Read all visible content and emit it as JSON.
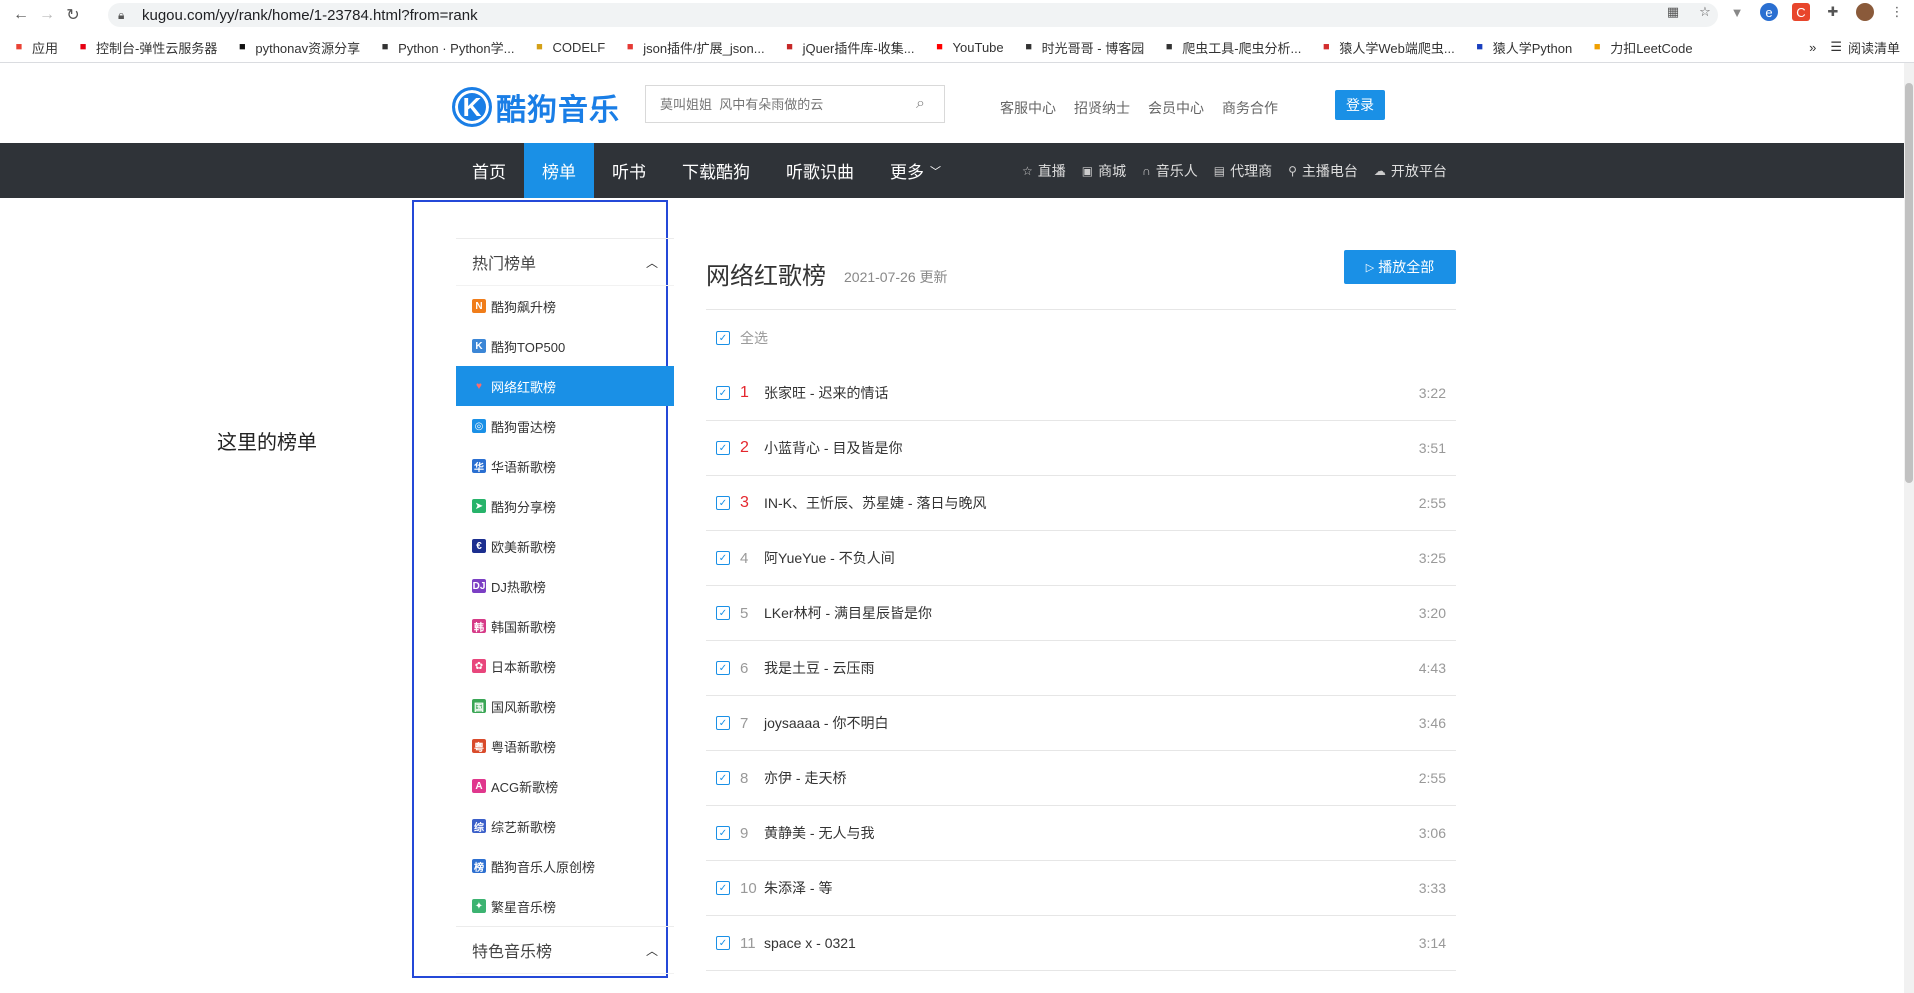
{
  "browser": {
    "url": "kugou.com/yy/rank/home/1-23784.html?from=rank",
    "bookmarks": [
      {
        "label": "应用",
        "icon": "apps-grid-icon",
        "color": "#ea4335"
      },
      {
        "label": "控制台-弹性云服务器",
        "icon": "huawei-icon",
        "color": "#e60012"
      },
      {
        "label": "pythonav资源分享",
        "icon": "github-icon",
        "color": "#111"
      },
      {
        "label": "Python · Python学...",
        "icon": "book-icon",
        "color": "#333"
      },
      {
        "label": "CODELF",
        "icon": "codelf-icon",
        "color": "#d4a017"
      },
      {
        "label": "json插件/扩展_json...",
        "icon": "ex-icon",
        "color": "#e53935"
      },
      {
        "label": "jQuer插件库-收集...",
        "icon": "jquery-icon",
        "color": "#c62828"
      },
      {
        "label": "YouTube",
        "icon": "youtube-icon",
        "color": "#ff0000"
      },
      {
        "label": "时光哥哥 - 博客园",
        "icon": "blog-icon",
        "color": "#333"
      },
      {
        "label": "爬虫工具-爬虫分析...",
        "icon": "globe-icon",
        "color": "#333"
      },
      {
        "label": "猿人学Web端爬虫...",
        "icon": "yuanrenxue-icon",
        "color": "#d32f2f"
      },
      {
        "label": "猿人学Python",
        "icon": "x-icon",
        "color": "#1a3fbf"
      },
      {
        "label": "力扣LeetCode",
        "icon": "leetcode-icon",
        "color": "#f0a000"
      }
    ],
    "overflow": "»",
    "reading_list": "阅读清单"
  },
  "header": {
    "logo_mark": "K",
    "logo_text": "酷狗音乐",
    "search_placeholder": "莫叫姐姐  风中有朵雨做的云",
    "links": [
      "客服中心",
      "招贤纳士",
      "会员中心",
      "商务合作"
    ],
    "login": "登录"
  },
  "nav": {
    "items": [
      {
        "label": "首页",
        "active": false
      },
      {
        "label": "榜单",
        "active": true
      },
      {
        "label": "听书",
        "active": false
      },
      {
        "label": "下载酷狗",
        "active": false
      },
      {
        "label": "听歌识曲",
        "active": false
      },
      {
        "label": "更多",
        "active": false
      }
    ],
    "right": [
      {
        "label": "直播",
        "icon": "star-icon"
      },
      {
        "label": "商城",
        "icon": "shop-icon"
      },
      {
        "label": "音乐人",
        "icon": "headphone-icon"
      },
      {
        "label": "代理商",
        "icon": "agent-icon"
      },
      {
        "label": "主播电台",
        "icon": "link-icon"
      },
      {
        "label": "开放平台",
        "icon": "cloud-icon"
      }
    ]
  },
  "note": "这里的榜单",
  "sidebar": {
    "section1": "热门榜单",
    "items": [
      {
        "label": "酷狗飙升榜",
        "color": "#f07d1a",
        "glyph": "N"
      },
      {
        "label": "酷狗TOP500",
        "color": "#3b86d6",
        "glyph": "K"
      },
      {
        "label": "网络红歌榜",
        "color": "#e4262d",
        "glyph": "♥",
        "active": true
      },
      {
        "label": "酷狗雷达榜",
        "color": "#1a90e6",
        "glyph": "◎"
      },
      {
        "label": "华语新歌榜",
        "color": "#2a6fd1",
        "glyph": "华"
      },
      {
        "label": "酷狗分享榜",
        "color": "#27b36a",
        "glyph": "➤"
      },
      {
        "label": "欧美新歌榜",
        "color": "#1b2e8f",
        "glyph": "€"
      },
      {
        "label": "DJ热歌榜",
        "color": "#7b3fc4",
        "glyph": "DJ"
      },
      {
        "label": "韩国新歌榜",
        "color": "#d63a87",
        "glyph": "韩"
      },
      {
        "label": "日本新歌榜",
        "color": "#e8467c",
        "glyph": "✿"
      },
      {
        "label": "国风新歌榜",
        "color": "#3aa655",
        "glyph": "国"
      },
      {
        "label": "粤语新歌榜",
        "color": "#d94b2b",
        "glyph": "粤"
      },
      {
        "label": "ACG新歌榜",
        "color": "#e0378d",
        "glyph": "A"
      },
      {
        "label": "综艺新歌榜",
        "color": "#3b5fc9",
        "glyph": "综"
      },
      {
        "label": "酷狗音乐人原创榜",
        "color": "#2d6fd0",
        "glyph": "榜"
      },
      {
        "label": "繁星音乐榜",
        "color": "#3cb371",
        "glyph": "✦"
      }
    ],
    "section2": "特色音乐榜"
  },
  "content": {
    "title": "网络红歌榜",
    "date": "2021-07-26 更新",
    "play_all": "播放全部",
    "select_all": "全选",
    "songs": [
      {
        "rank": "1",
        "name": "张家旺 - 迟来的情话",
        "duration": "3:22",
        "top": true
      },
      {
        "rank": "2",
        "name": "小蓝背心 - 目及皆是你",
        "duration": "3:51",
        "top": true
      },
      {
        "rank": "3",
        "name": "IN-K、王忻辰、苏星婕 - 落日与晚风",
        "duration": "2:55",
        "top": true
      },
      {
        "rank": "4",
        "name": "阿YueYue - 不负人间",
        "duration": "3:25",
        "top": false
      },
      {
        "rank": "5",
        "name": "LKer林柯 - 满目星辰皆是你",
        "duration": "3:20",
        "top": false
      },
      {
        "rank": "6",
        "name": "我是土豆 - 云压雨",
        "duration": "4:43",
        "top": false
      },
      {
        "rank": "7",
        "name": "joysaaaa - 你不明白",
        "duration": "3:46",
        "top": false
      },
      {
        "rank": "8",
        "name": "亦伊 - 走天桥",
        "duration": "2:55",
        "top": false
      },
      {
        "rank": "9",
        "name": "黄静美 - 无人与我",
        "duration": "3:06",
        "top": false
      },
      {
        "rank": "10",
        "name": "朱添泽 - 等",
        "duration": "3:33",
        "top": false
      },
      {
        "rank": "11",
        "name": "space x - 0321",
        "duration": "3:14",
        "top": false
      }
    ]
  },
  "colors": {
    "accent": "#1a90e6",
    "nav_bg": "#2f3338",
    "rank_red": "#e4262d",
    "annotation_box": "#2448d8"
  }
}
